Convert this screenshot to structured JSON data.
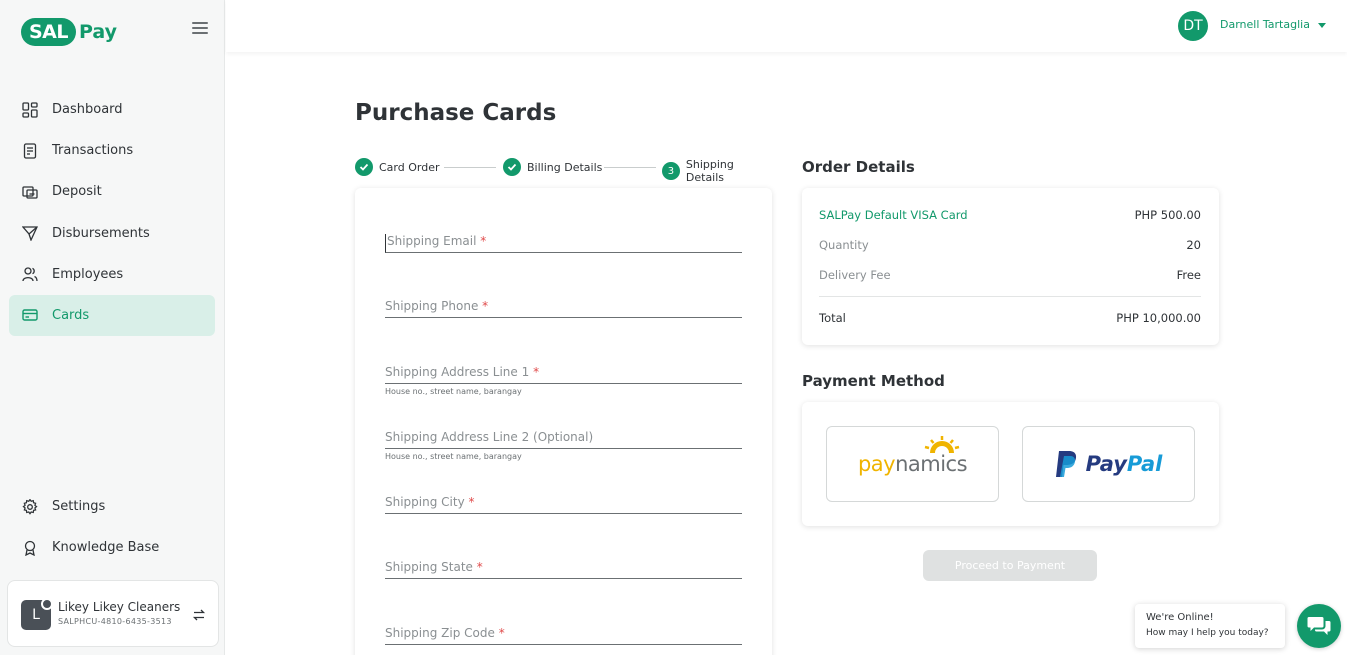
{
  "brand": {
    "badge": "SAL",
    "suffix": "Pay"
  },
  "sidebar": {
    "items": [
      {
        "label": "Dashboard",
        "icon": "dashboard-icon"
      },
      {
        "label": "Transactions",
        "icon": "receipt-icon"
      },
      {
        "label": "Deposit",
        "icon": "deposit-icon"
      },
      {
        "label": "Disbursements",
        "icon": "send-icon"
      },
      {
        "label": "Employees",
        "icon": "users-icon"
      },
      {
        "label": "Cards",
        "icon": "card-icon",
        "active": true
      }
    ],
    "bottom_items": [
      {
        "label": "Settings",
        "icon": "gear-icon"
      },
      {
        "label": "Knowledge Base",
        "icon": "badge-icon"
      }
    ],
    "account": {
      "initial": "L",
      "name": "Likey Likey Cleaners",
      "id": "SALPHCU-4810-6435-3513"
    }
  },
  "header": {
    "user_initials": "DT",
    "user_name": "Darnell Tartaglia"
  },
  "page": {
    "title": "Purchase Cards"
  },
  "stepper": {
    "steps": [
      {
        "label": "Card Order",
        "state": "done"
      },
      {
        "label": "Billing Details",
        "state": "done"
      },
      {
        "label": "Shipping Details",
        "state": "current",
        "number": "3"
      }
    ]
  },
  "form": {
    "fields": [
      {
        "label": "Shipping Email",
        "required": "*",
        "hint": ""
      },
      {
        "label": "Shipping Phone",
        "required": "*",
        "hint": ""
      },
      {
        "label": "Shipping Address Line 1",
        "required": "*",
        "hint": "House no., street name, barangay"
      },
      {
        "label": "Shipping Address Line 2 (Optional)",
        "required": "",
        "hint": "House no., street name, barangay"
      },
      {
        "label": "Shipping City",
        "required": "*",
        "hint": ""
      },
      {
        "label": "Shipping State",
        "required": "*",
        "hint": ""
      },
      {
        "label": "Shipping Zip Code",
        "required": "*",
        "hint": ""
      }
    ]
  },
  "order": {
    "title": "Order Details",
    "product": {
      "label": "SALPay Default VISA Card",
      "value": "PHP 500.00"
    },
    "quantity": {
      "label": "Quantity",
      "value": "20"
    },
    "delivery": {
      "label": "Delivery Fee",
      "value": "Free"
    },
    "total": {
      "label": "Total",
      "value": "PHP 10,000.00"
    }
  },
  "payment": {
    "title": "Payment Method",
    "paynamics": {
      "part1": "pay",
      "part2": "namics"
    },
    "paypal": {
      "part1": "Pay",
      "part2": "Pal"
    },
    "proceed_label": "Proceed to Payment"
  },
  "chat": {
    "line1": "We're Online!",
    "line2": "How may I help you today?"
  },
  "colors": {
    "accent": "#12996b",
    "active_bg": "#d9efe8",
    "required": "#e04a4a"
  }
}
